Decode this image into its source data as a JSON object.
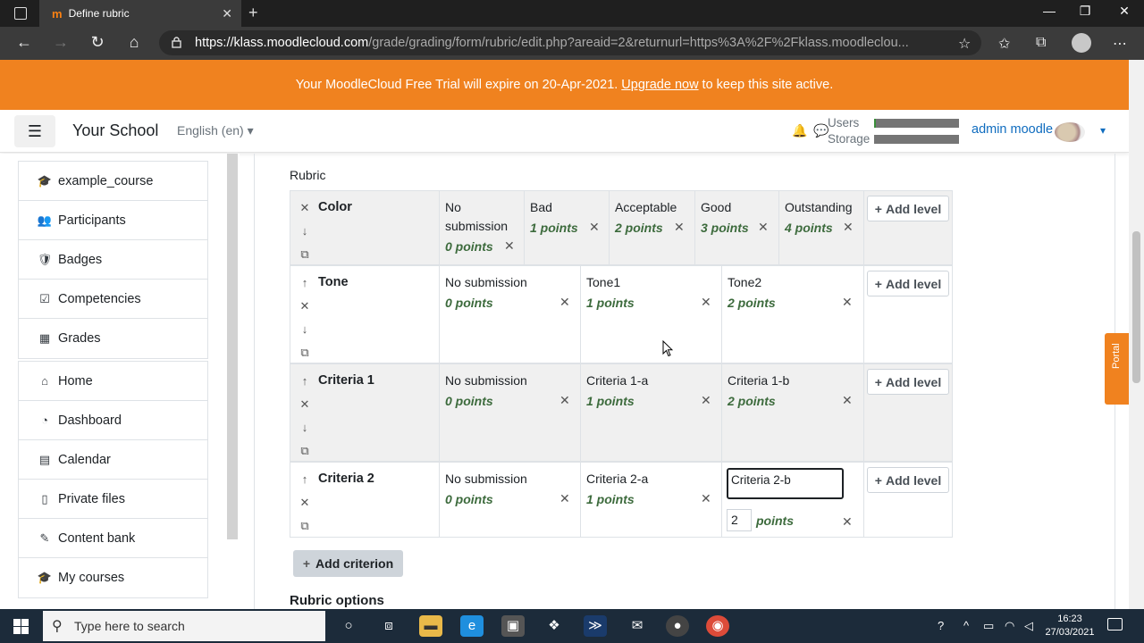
{
  "browser": {
    "tab_title": "Define rubric",
    "url_host": "https://klass.moodlecloud.com",
    "url_path": "/grade/grading/form/rubric/edit.php?areaid=2&returnurl=https%3A%2F%2Fklass.moodleclou..."
  },
  "banner": {
    "text_before": "Your MoodleCloud Free Trial will expire on 20-Apr-2021.",
    "link": "Upgrade now",
    "text_after": "to keep this site active."
  },
  "navbar": {
    "site_name": "Your School",
    "language": "English (en)",
    "users_label": "Users",
    "storage_label": "Storage",
    "users_usage": 0.02,
    "storage_usage": 0.0,
    "user_name": "admin moodle"
  },
  "sidebar": {
    "course_items": [
      {
        "label": "example_course",
        "icon": "graduation-cap-icon",
        "glyph": "🎓"
      },
      {
        "label": "Participants",
        "icon": "users-icon",
        "glyph": "👥"
      },
      {
        "label": "Badges",
        "icon": "shield-icon",
        "glyph": "🛡"
      },
      {
        "label": "Competencies",
        "icon": "checkbox-icon",
        "glyph": "☑"
      },
      {
        "label": "Grades",
        "icon": "table-icon",
        "glyph": "▦"
      }
    ],
    "site_items": [
      {
        "label": "Home",
        "icon": "home-icon",
        "glyph": "⌂"
      },
      {
        "label": "Dashboard",
        "icon": "dashboard-icon",
        "glyph": "◔"
      },
      {
        "label": "Calendar",
        "icon": "calendar-icon",
        "glyph": "▤"
      },
      {
        "label": "Private files",
        "icon": "file-icon",
        "glyph": "▯"
      },
      {
        "label": "Content bank",
        "icon": "brush-icon",
        "glyph": "✎"
      },
      {
        "label": "My courses",
        "icon": "graduation-cap-icon",
        "glyph": "🎓"
      }
    ]
  },
  "rubric": {
    "label": "Rubric",
    "add_level_label": "Add level",
    "points_word": "points",
    "criteria": [
      {
        "name": "Color",
        "levels": [
          {
            "name": "No submission",
            "points": "0 points"
          },
          {
            "name": "Bad",
            "points": "1 points"
          },
          {
            "name": "Acceptable",
            "points": "2 points"
          },
          {
            "name": "Good",
            "points": "3 points"
          },
          {
            "name": "Outstanding",
            "points": "4 points"
          }
        ]
      },
      {
        "name": "Tone",
        "levels": [
          {
            "name": "No submission",
            "points": "0 points"
          },
          {
            "name": "Tone1",
            "points": "1 points"
          },
          {
            "name": "Tone2",
            "points": "2 points"
          }
        ]
      },
      {
        "name": "Criteria 1",
        "levels": [
          {
            "name": "No submission",
            "points": "0 points"
          },
          {
            "name": "Criteria 1-a",
            "points": "1 points"
          },
          {
            "name": "Criteria 1-b",
            "points": "2 points"
          }
        ]
      },
      {
        "name": "Criteria 2",
        "levels": [
          {
            "name": "No submission",
            "points": "0 points"
          },
          {
            "name": "Criteria 2-a",
            "points": "1 points"
          },
          {
            "name": "Criteria 2-b",
            "points_value": "2"
          }
        ]
      }
    ],
    "add_criterion_label": "Add criterion",
    "options_heading": "Rubric options"
  },
  "portal_label": "Portal",
  "taskbar": {
    "search_placeholder": "Type here to search",
    "time": "16:23",
    "date": "27/03/2021"
  },
  "colors": {
    "accent_orange": "#f0821f",
    "link_blue": "#0f6cbf",
    "points_green": "#3d6b3d"
  }
}
